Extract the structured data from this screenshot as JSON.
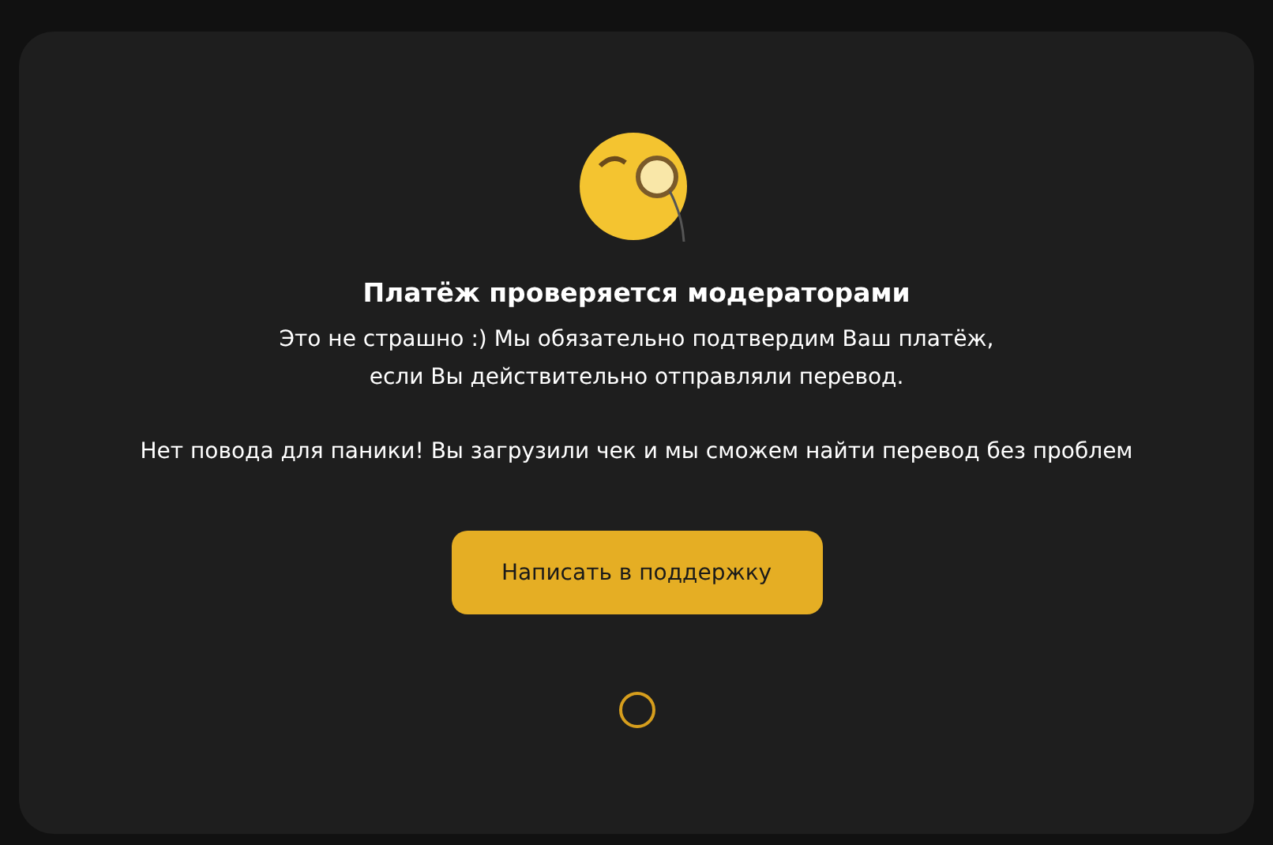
{
  "dialog": {
    "title": "Платёж проверяется модераторами",
    "messages": [
      "Это не страшно :) Мы обязательно подтвердим Ваш платёж,\nесли Вы действительно отправляли перевод.",
      "Нет повода для паники! Вы загрузили чек и мы сможем найти перевод без проблем"
    ],
    "button": {
      "label": "Написать в поддержку"
    }
  }
}
